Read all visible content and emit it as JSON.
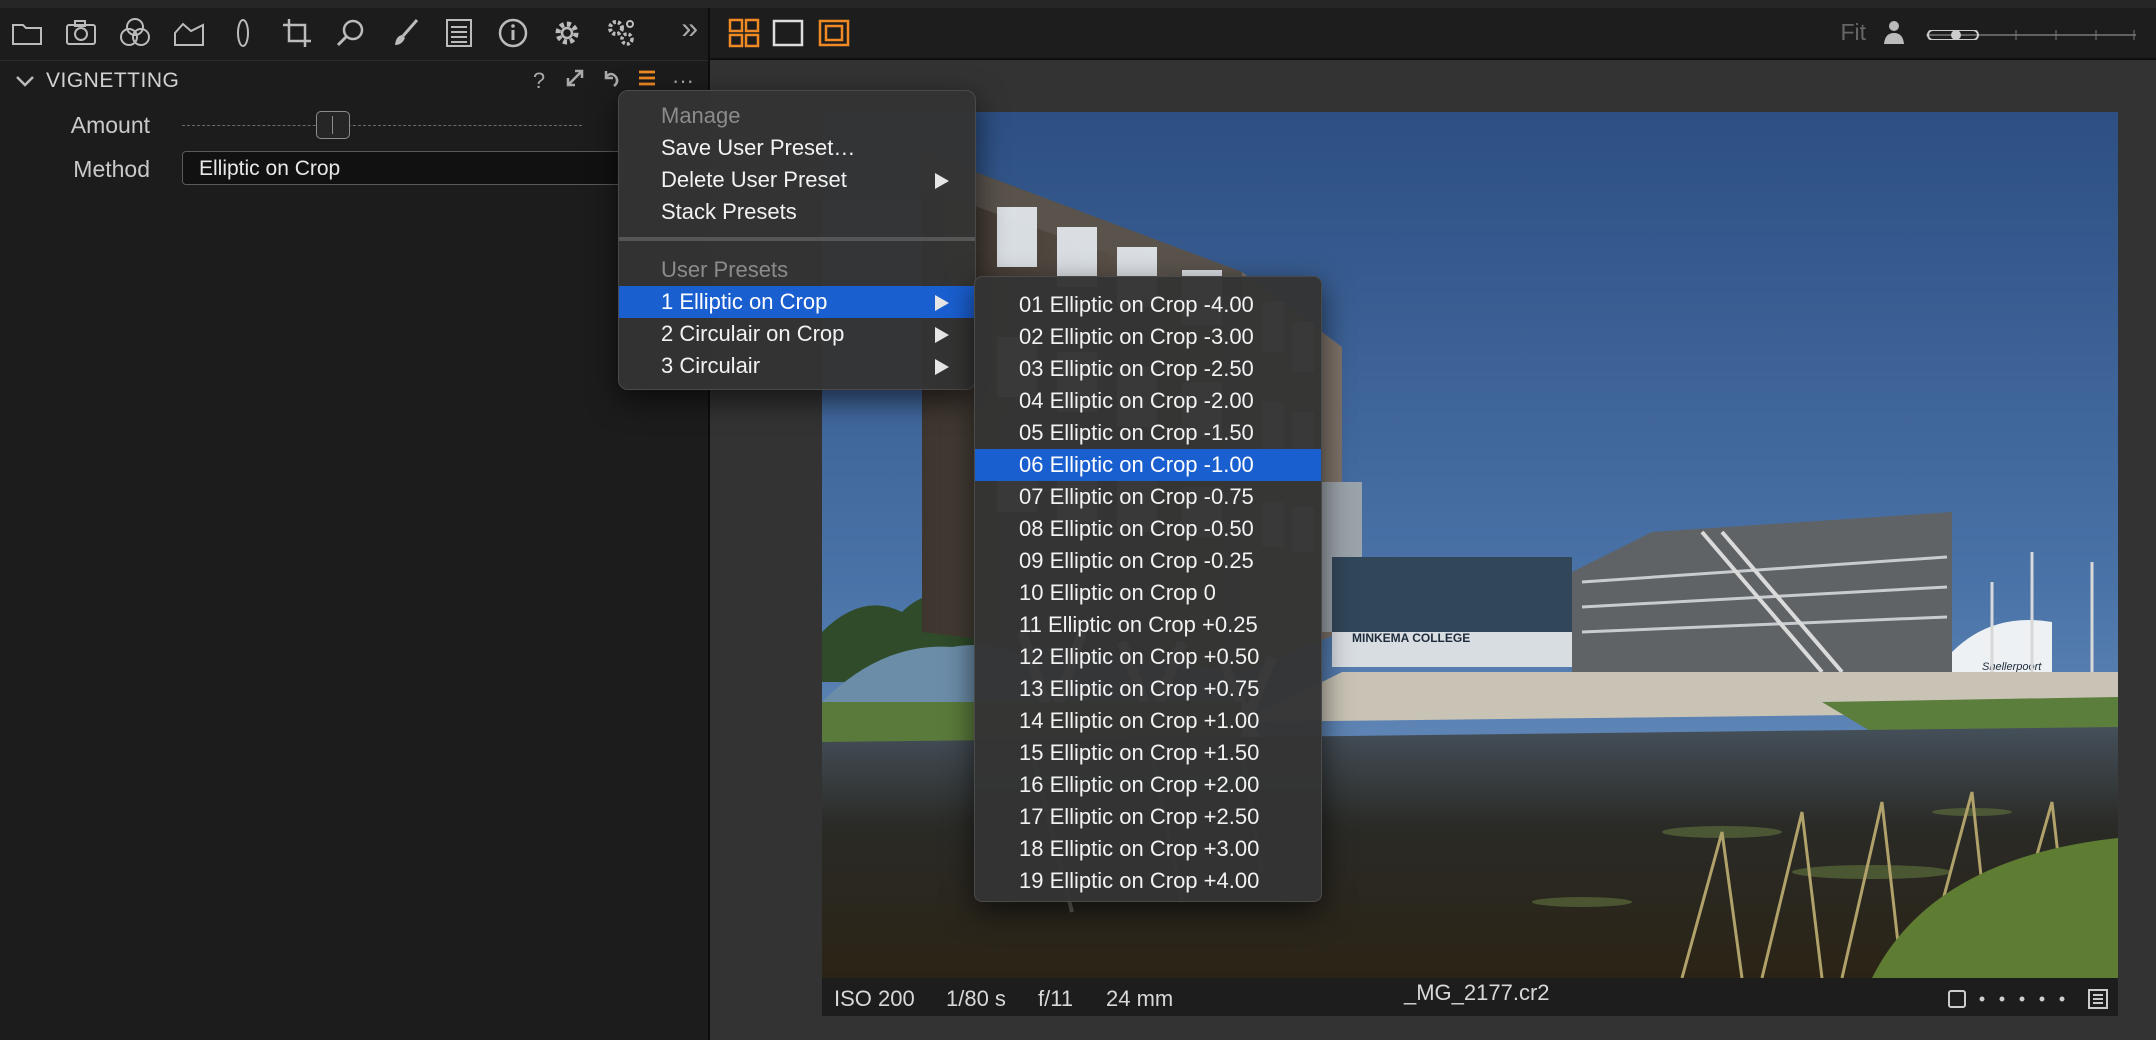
{
  "colors": {
    "accent": "#f08a24",
    "selection": "#1a5fd0",
    "panel": "#1c1c1c",
    "viewer_bg": "#333333"
  },
  "left_toolbar": {
    "icons": [
      "folder-icon",
      "camera-icon",
      "color-circles-icon",
      "exposure-icon",
      "lens-icon",
      "crop-icon",
      "search-icon",
      "brush-icon",
      "metadata-icon",
      "info-icon",
      "gear-icon",
      "gears-icon"
    ],
    "more": "»"
  },
  "tool": {
    "title": "VIGNETTING",
    "header_icons": {
      "help": "?",
      "more": "···"
    },
    "amount_label": "Amount",
    "method_label": "Method",
    "method_value": "Elliptic on Crop"
  },
  "viewer_toolbar": {
    "fit_label": "Fit"
  },
  "info_bar": {
    "iso": "ISO 200",
    "shutter": "1/80 s",
    "aperture": "f/11",
    "focal": "24 mm",
    "filename": "_MG_2177.cr2"
  },
  "menu": {
    "manage_header": "Manage",
    "save": "Save User Preset…",
    "delete": "Delete User Preset",
    "stack": "Stack Presets",
    "user_header": "User Presets",
    "presets": [
      "1 Elliptic on Crop",
      "2 Circulair on Crop",
      "3 Circulair"
    ]
  },
  "submenu": {
    "items": [
      "01 Elliptic on Crop -4.00",
      "02 Elliptic on Crop -3.00",
      "03 Elliptic on Crop -2.50",
      "04 Elliptic on Crop -2.00",
      "05 Elliptic on Crop -1.50",
      "06 Elliptic on Crop -1.00",
      "07 Elliptic on Crop -0.75",
      "08 Elliptic on Crop -0.50",
      "09 Elliptic on Crop -0.25",
      "10 Elliptic on Crop 0",
      "11 Elliptic on Crop +0.25",
      "12 Elliptic on Crop +0.50",
      "13 Elliptic on Crop +0.75",
      "14 Elliptic on Crop +1.00",
      "15 Elliptic on Crop +1.50",
      "16 Elliptic on Crop +2.00",
      "17 Elliptic on Crop +2.50",
      "18 Elliptic on Crop +3.00",
      "19 Elliptic on Crop +4.00"
    ],
    "selected_index": 5
  },
  "photo_signs": {
    "college": "MINKEMA COLLEGE",
    "sign": "Snellerpoort"
  }
}
